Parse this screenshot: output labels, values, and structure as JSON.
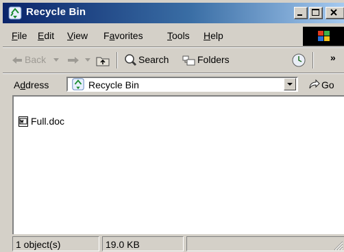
{
  "window": {
    "title": "Recycle Bin"
  },
  "menu": [
    {
      "pre": "",
      "key": "F",
      "post": "ile"
    },
    {
      "pre": "",
      "key": "E",
      "post": "dit"
    },
    {
      "pre": "",
      "key": "V",
      "post": "iew"
    },
    {
      "pre": "F",
      "key": "a",
      "post": "vorites"
    },
    {
      "pre": "",
      "key": "T",
      "post": "ools"
    },
    {
      "pre": "",
      "key": "H",
      "post": "elp"
    }
  ],
  "toolbar": {
    "back": "Back",
    "search": "Search",
    "folders": "Folders",
    "more": "»"
  },
  "address": {
    "label_pre": "A",
    "label_key": "d",
    "label_post": "dress",
    "value": "Recycle Bin",
    "go": "Go"
  },
  "files": [
    {
      "name": "Full.doc"
    }
  ],
  "status": {
    "objects": "1 object(s)",
    "size": "19.0 KB"
  },
  "colors": {
    "title_start": "#0a246a",
    "title_end": "#a6caf0",
    "chrome": "#d4d0c8"
  },
  "icons": [
    "recycle-bin-icon",
    "minimize-icon",
    "maximize-icon",
    "close-icon",
    "windows-logo-icon",
    "back-arrow-icon",
    "forward-arrow-icon",
    "up-folder-icon",
    "search-icon",
    "folders-icon",
    "history-icon",
    "dropdown-arrow-icon",
    "go-arrow-icon",
    "document-icon",
    "resize-grip-icon"
  ]
}
